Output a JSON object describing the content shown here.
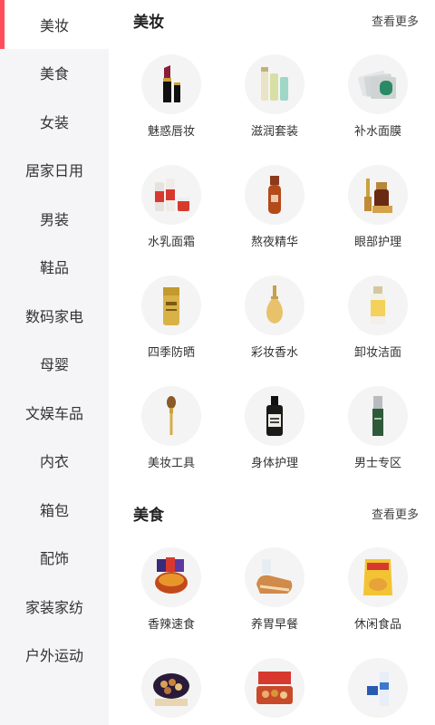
{
  "sidebar": {
    "items": [
      {
        "label": "美妆",
        "active": true
      },
      {
        "label": "美食"
      },
      {
        "label": "女装"
      },
      {
        "label": "居家日用"
      },
      {
        "label": "男装"
      },
      {
        "label": "鞋品"
      },
      {
        "label": "数码家电"
      },
      {
        "label": "母婴"
      },
      {
        "label": "文娱车品"
      },
      {
        "label": "内衣"
      },
      {
        "label": "箱包"
      },
      {
        "label": "配饰"
      },
      {
        "label": "家装家纺"
      },
      {
        "label": "户外运动"
      }
    ]
  },
  "sections": [
    {
      "title": "美妆",
      "more": "查看更多",
      "items": [
        {
          "label": "魅惑唇妆",
          "icon": "lipstick-icon"
        },
        {
          "label": "滋润套装",
          "icon": "skincare-tubes-icon"
        },
        {
          "label": "补水面膜",
          "icon": "face-mask-icon"
        },
        {
          "label": "水乳面霜",
          "icon": "cream-set-icon"
        },
        {
          "label": "熬夜精华",
          "icon": "serum-bottle-icon"
        },
        {
          "label": "眼部护理",
          "icon": "eye-care-icon"
        },
        {
          "label": "四季防晒",
          "icon": "sunscreen-icon"
        },
        {
          "label": "彩妆香水",
          "icon": "perfume-icon"
        },
        {
          "label": "卸妆洁面",
          "icon": "cleanser-icon"
        },
        {
          "label": "美妆工具",
          "icon": "makeup-brush-icon"
        },
        {
          "label": "身体护理",
          "icon": "body-oil-icon"
        },
        {
          "label": "男士专区",
          "icon": "mens-bottle-icon"
        }
      ]
    },
    {
      "title": "美食",
      "more": "查看更多",
      "items": [
        {
          "label": "香辣速食",
          "icon": "noodles-icon"
        },
        {
          "label": "养胃早餐",
          "icon": "bread-icon"
        },
        {
          "label": "休闲食品",
          "icon": "chips-icon"
        },
        {
          "label": "",
          "icon": "cookies-icon"
        },
        {
          "label": "",
          "icon": "nuts-gift-box-icon"
        },
        {
          "label": "",
          "icon": "milk-icon"
        }
      ]
    }
  ]
}
